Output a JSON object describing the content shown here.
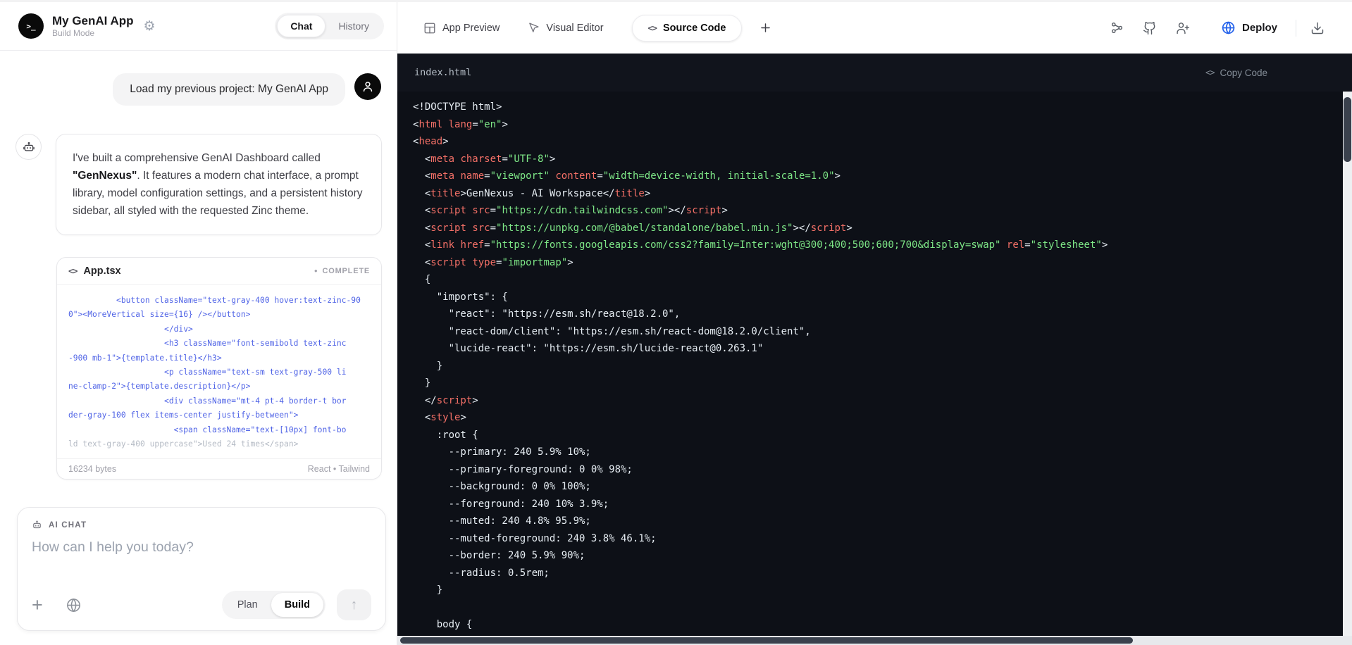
{
  "colors": {
    "accent_blue": "#2563eb",
    "card_code_blue": "#4f63e6",
    "editor_bg": "#0d1017",
    "editor_tag_red": "#f47067",
    "editor_string_green": "#7ee787",
    "editor_text": "#e6edf3"
  },
  "icons": {
    "gear": "⚙",
    "arrow_up": "↑",
    "plus": "+",
    "code_glyph": "<>",
    "status_dot": "●"
  },
  "left": {
    "header": {
      "logo_glyph": ">_",
      "title": "My GenAI App",
      "subtitle": "Build Mode",
      "tabs": [
        {
          "label": "Chat"
        },
        {
          "label": "History"
        }
      ]
    },
    "chat": {
      "user_message": "Load my previous project: My GenAI App",
      "ai_message_segments": [
        {
          "text": "I've built a comprehensive GenAI Dashboard called ",
          "bold": false
        },
        {
          "text": "\"GenNexus\"",
          "bold": true
        },
        {
          "text": ". It features a modern chat interface, a prompt library, model configuration settings, and a persistent history sidebar, all styled with the requested Zinc theme.",
          "bold": false
        }
      ]
    },
    "code_card": {
      "filename": "App.tsx",
      "status": "COMPLETE",
      "lines": [
        {
          "text": "          <button className=\"text-gray-400 hover:text-zinc-90",
          "muted": false
        },
        {
          "text": "0\"><MoreVertical size={16} /></button>",
          "muted": false
        },
        {
          "text": "                    </div>",
          "muted": false
        },
        {
          "text": "                    <h3 className=\"font-semibold text-zinc",
          "muted": false
        },
        {
          "text": "-900 mb-1\">{template.title}</h3>",
          "muted": false
        },
        {
          "text": "                    <p className=\"text-sm text-gray-500 li",
          "muted": false
        },
        {
          "text": "ne-clamp-2\">{template.description}</p>",
          "muted": false
        },
        {
          "text": "                    <div className=\"mt-4 pt-4 border-t bor",
          "muted": false
        },
        {
          "text": "der-gray-100 flex items-center justify-between\">",
          "muted": false
        },
        {
          "text": "                      <span className=\"text-[10px] font-bo",
          "muted": false
        },
        {
          "text": "ld text-gray-400 uppercase\">Used 24 times</span>",
          "muted": true
        }
      ],
      "bytes": "16234 bytes",
      "stack": "React • Tailwind"
    },
    "composer": {
      "label": "AI CHAT",
      "placeholder": "How can I help you today?",
      "modes": [
        {
          "label": "Plan"
        },
        {
          "label": "Build"
        }
      ]
    }
  },
  "right": {
    "tabs": [
      {
        "label": "App Preview"
      },
      {
        "label": "Visual Editor"
      },
      {
        "label": "Source Code"
      }
    ],
    "deploy_label": "Deploy",
    "editor": {
      "filename": "index.html",
      "copy_label": "Copy Code",
      "code_lines": [
        [
          [
            "w",
            "<!DOCTYPE html>"
          ]
        ],
        [
          [
            "w",
            "<"
          ],
          [
            "r",
            "html"
          ],
          [
            "w",
            " "
          ],
          [
            "r",
            "lang"
          ],
          [
            "w",
            "="
          ],
          [
            "g",
            "\"en\""
          ],
          [
            "w",
            ">"
          ]
        ],
        [
          [
            "w",
            "<"
          ],
          [
            "r",
            "head"
          ],
          [
            "w",
            ">"
          ]
        ],
        [
          [
            "w",
            "  <"
          ],
          [
            "r",
            "meta"
          ],
          [
            "w",
            " "
          ],
          [
            "r",
            "charset"
          ],
          [
            "w",
            "="
          ],
          [
            "g",
            "\"UTF-8\""
          ],
          [
            "w",
            ">"
          ]
        ],
        [
          [
            "w",
            "  <"
          ],
          [
            "r",
            "meta"
          ],
          [
            "w",
            " "
          ],
          [
            "r",
            "name"
          ],
          [
            "w",
            "="
          ],
          [
            "g",
            "\"viewport\""
          ],
          [
            "w",
            " "
          ],
          [
            "r",
            "content"
          ],
          [
            "w",
            "="
          ],
          [
            "g",
            "\"width=device-width, initial-scale=1.0\""
          ],
          [
            "w",
            ">"
          ]
        ],
        [
          [
            "w",
            "  <"
          ],
          [
            "r",
            "title"
          ],
          [
            "w",
            ">GenNexus - AI Workspace</"
          ],
          [
            "r",
            "title"
          ],
          [
            "w",
            ">"
          ]
        ],
        [
          [
            "w",
            "  <"
          ],
          [
            "r",
            "script"
          ],
          [
            "w",
            " "
          ],
          [
            "r",
            "src"
          ],
          [
            "w",
            "="
          ],
          [
            "g",
            "\"https://cdn.tailwindcss.com\""
          ],
          [
            "w",
            "></"
          ],
          [
            "r",
            "script"
          ],
          [
            "w",
            ">"
          ]
        ],
        [
          [
            "w",
            "  <"
          ],
          [
            "r",
            "script"
          ],
          [
            "w",
            " "
          ],
          [
            "r",
            "src"
          ],
          [
            "w",
            "="
          ],
          [
            "g",
            "\"https://unpkg.com/@babel/standalone/babel.min.js\""
          ],
          [
            "w",
            "></"
          ],
          [
            "r",
            "script"
          ],
          [
            "w",
            ">"
          ]
        ],
        [
          [
            "w",
            "  <"
          ],
          [
            "r",
            "link"
          ],
          [
            "w",
            " "
          ],
          [
            "r",
            "href"
          ],
          [
            "w",
            "="
          ],
          [
            "g",
            "\"https://fonts.googleapis.com/css2?family=Inter:wght@300;400;500;600;700&display=swap\""
          ],
          [
            "w",
            " "
          ],
          [
            "r",
            "rel"
          ],
          [
            "w",
            "="
          ],
          [
            "g",
            "\"stylesheet\""
          ],
          [
            "w",
            ">"
          ]
        ],
        [
          [
            "w",
            "  <"
          ],
          [
            "r",
            "script"
          ],
          [
            "w",
            " "
          ],
          [
            "r",
            "type"
          ],
          [
            "w",
            "="
          ],
          [
            "g",
            "\"importmap\""
          ],
          [
            "w",
            ">"
          ]
        ],
        [
          [
            "w",
            "  {"
          ]
        ],
        [
          [
            "w",
            "    \"imports\": {"
          ]
        ],
        [
          [
            "w",
            "      \"react\": \"https://esm.sh/react@18.2.0\","
          ]
        ],
        [
          [
            "w",
            "      \"react-dom/client\": \"https://esm.sh/react-dom@18.2.0/client\","
          ]
        ],
        [
          [
            "w",
            "      \"lucide-react\": \"https://esm.sh/lucide-react@0.263.1\""
          ]
        ],
        [
          [
            "w",
            "    }"
          ]
        ],
        [
          [
            "w",
            "  }"
          ]
        ],
        [
          [
            "w",
            "  </"
          ],
          [
            "r",
            "script"
          ],
          [
            "w",
            ">"
          ]
        ],
        [
          [
            "w",
            "  <"
          ],
          [
            "r",
            "style"
          ],
          [
            "w",
            ">"
          ]
        ],
        [
          [
            "w",
            "    :root {"
          ]
        ],
        [
          [
            "w",
            "      --primary: 240 5.9% 10%;"
          ]
        ],
        [
          [
            "w",
            "      --primary-foreground: 0 0% 98%;"
          ]
        ],
        [
          [
            "w",
            "      --background: 0 0% 100%;"
          ]
        ],
        [
          [
            "w",
            "      --foreground: 240 10% 3.9%;"
          ]
        ],
        [
          [
            "w",
            "      --muted: 240 4.8% 95.9%;"
          ]
        ],
        [
          [
            "w",
            "      --muted-foreground: 240 3.8% 46.1%;"
          ]
        ],
        [
          [
            "w",
            "      --border: 240 5.9% 90%;"
          ]
        ],
        [
          [
            "w",
            "      --radius: 0.5rem;"
          ]
        ],
        [
          [
            "w",
            "    }"
          ]
        ],
        [
          [
            "w",
            ""
          ]
        ],
        [
          [
            "w",
            "    body {"
          ]
        ]
      ]
    }
  }
}
